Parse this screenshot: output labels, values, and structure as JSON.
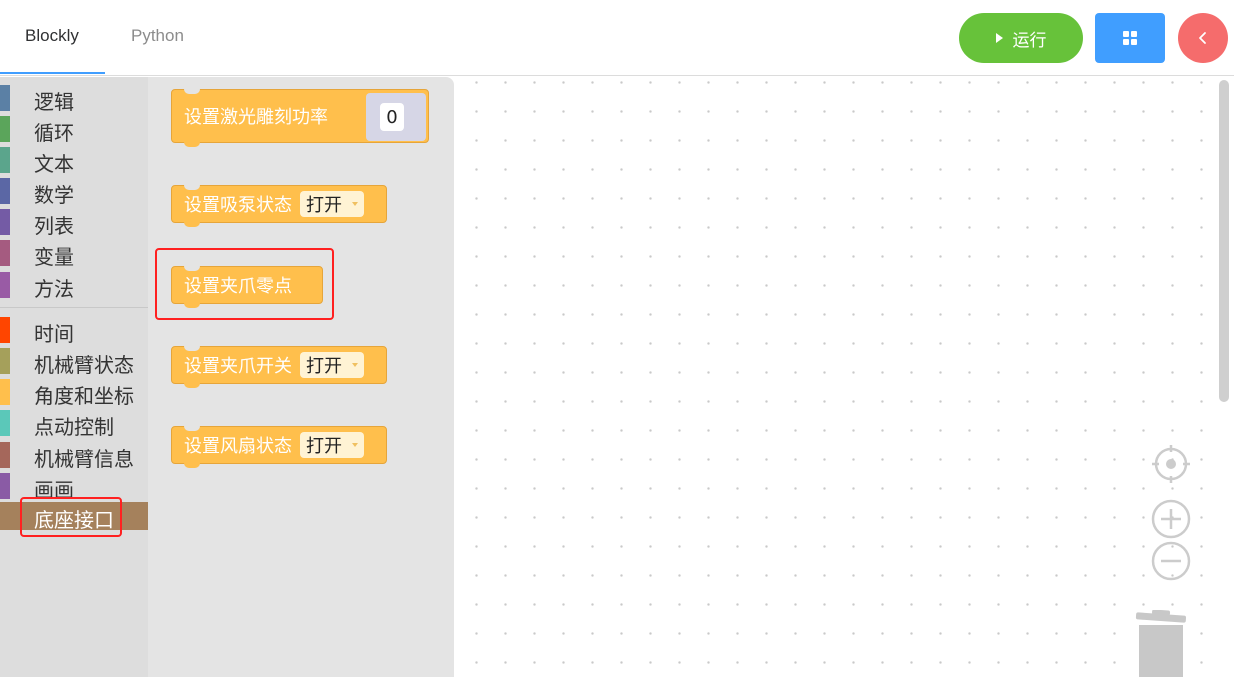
{
  "tabs": [
    {
      "label": "Blockly",
      "active": true
    },
    {
      "label": "Python",
      "active": false
    }
  ],
  "toolbar": {
    "run_label": "运行",
    "run_color": "#67c23a",
    "grid_color": "#409eff",
    "back_color": "#f56c6c",
    "back_icon": "‹"
  },
  "categories": [
    {
      "label": "逻辑",
      "color": "#5b80a5"
    },
    {
      "label": "循环",
      "color": "#5ba55b"
    },
    {
      "label": "文本",
      "color": "#5ba58c"
    },
    {
      "label": "数学",
      "color": "#5b67a5"
    },
    {
      "label": "列表",
      "color": "#745ba5"
    },
    {
      "label": "变量",
      "color": "#a55b80"
    },
    {
      "label": "方法",
      "color": "#995ba5"
    },
    {
      "label": "时间",
      "color": "#ff4500"
    },
    {
      "label": "机械臂状态",
      "color": "#a5a05b"
    },
    {
      "label": "角度和坐标",
      "color": "#ffbf4c"
    },
    {
      "label": "点动控制",
      "color": "#5bc8b9"
    },
    {
      "label": "机械臂信息",
      "color": "#a5675b"
    },
    {
      "label": "画画",
      "color": "#8a5ba5"
    },
    {
      "label": "底座接口",
      "color": "#a5815c",
      "selected": true
    }
  ],
  "blocks": [
    {
      "label": "设置激光雕刻功率",
      "value": "0"
    },
    {
      "label": "设置吸泵状态",
      "dropdown": "打开"
    },
    {
      "label": "设置夹爪零点"
    },
    {
      "label": "设置夹爪开关",
      "dropdown": "打开"
    },
    {
      "label": "设置风扇状态",
      "dropdown": "打开"
    }
  ],
  "workspace_controls": [
    "recenter-icon",
    "zoom-in-icon",
    "zoom-out-icon",
    "trash-icon"
  ]
}
